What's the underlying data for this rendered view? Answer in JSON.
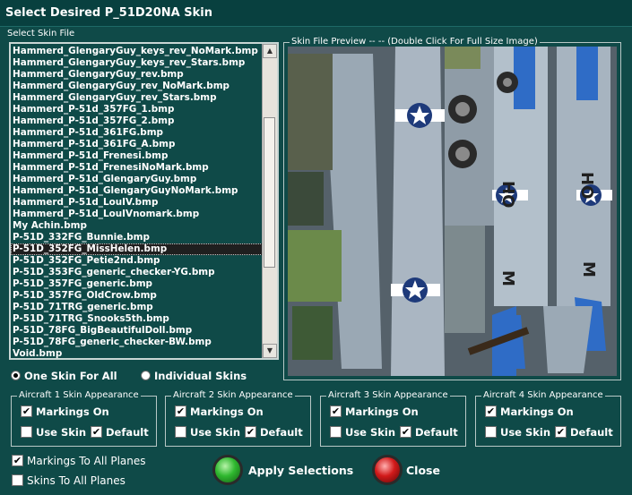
{
  "window": {
    "title": "Select Desired P_51D20NA Skin"
  },
  "skin_list": {
    "label": "Select Skin File",
    "items": [
      "Hammerd_GlengaryGuy_keys_rev_NoMark.bmp",
      "Hammerd_GlengaryGuy_keys_rev_Stars.bmp",
      "Hammerd_GlengaryGuy_rev.bmp",
      "Hammerd_GlengaryGuy_rev_NoMark.bmp",
      "Hammerd_GlengaryGuy_rev_Stars.bmp",
      "Hammerd_P-51d_357FG_1.bmp",
      "Hammerd_P-51d_357FG_2.bmp",
      "Hammerd_P-51d_361FG.bmp",
      "Hammerd_P-51d_361FG_A.bmp",
      "Hammerd_P-51d_Frenesi.bmp",
      "Hammerd_P-51d_FrenesiNoMark.bmp",
      "Hammerd_P-51d_GlengaryGuy.bmp",
      "Hammerd_P-51d_GlengaryGuyNoMark.bmp",
      "Hammerd_P-51d_LouIV.bmp",
      "Hammerd_P-51d_LouIVnomark.bmp",
      "My Achin.bmp",
      "P-51D_332FG_Bunnie.bmp",
      "P-51D_352FG_MissHelen.bmp",
      "P-51D_352FG_Petie2nd.bmp",
      "P-51D_353FG_generic_checker-YG.bmp",
      "P-51D_357FG_generic.bmp",
      "P-51D_357FG_OldCrow.bmp",
      "P-51D_71TRG_generic.bmp",
      "P-51D_71TRG_Snooks5th.bmp",
      "P-51D_78FG_BigBeautifulDoll.bmp",
      "P-51D_78FG_generic_checker-BW.bmp",
      "Void.bmp"
    ],
    "selected_index": 17
  },
  "preview": {
    "label": "Skin File Preview  -- --  (Double Click For Full Size Image)"
  },
  "mode": {
    "one_skin": "One Skin For All",
    "individual": "Individual Skins",
    "selected": "one_skin"
  },
  "aircraft_groups": [
    {
      "title": "Aircraft 1 Skin Appearance",
      "markings": "Markings On",
      "use_skin": "Use Skin",
      "default": "Default"
    },
    {
      "title": "Aircraft 2 Skin Appearance",
      "markings": "Markings On",
      "use_skin": "Use Skin",
      "default": "Default"
    },
    {
      "title": "Aircraft 3 Skin Appearance",
      "markings": "Markings On",
      "use_skin": "Use Skin",
      "default": "Default"
    },
    {
      "title": "Aircraft 4 Skin Appearance",
      "markings": "Markings On",
      "use_skin": "Use Skin",
      "default": "Default"
    }
  ],
  "bottom": {
    "markings_all": "Markings To All Planes",
    "skins_all": "Skins To All Planes",
    "apply": "Apply Selections",
    "close": "Close"
  },
  "colors": {
    "background": "#0f4a48",
    "apply_led": "#2fb82f",
    "close_led": "#d21a1a"
  }
}
